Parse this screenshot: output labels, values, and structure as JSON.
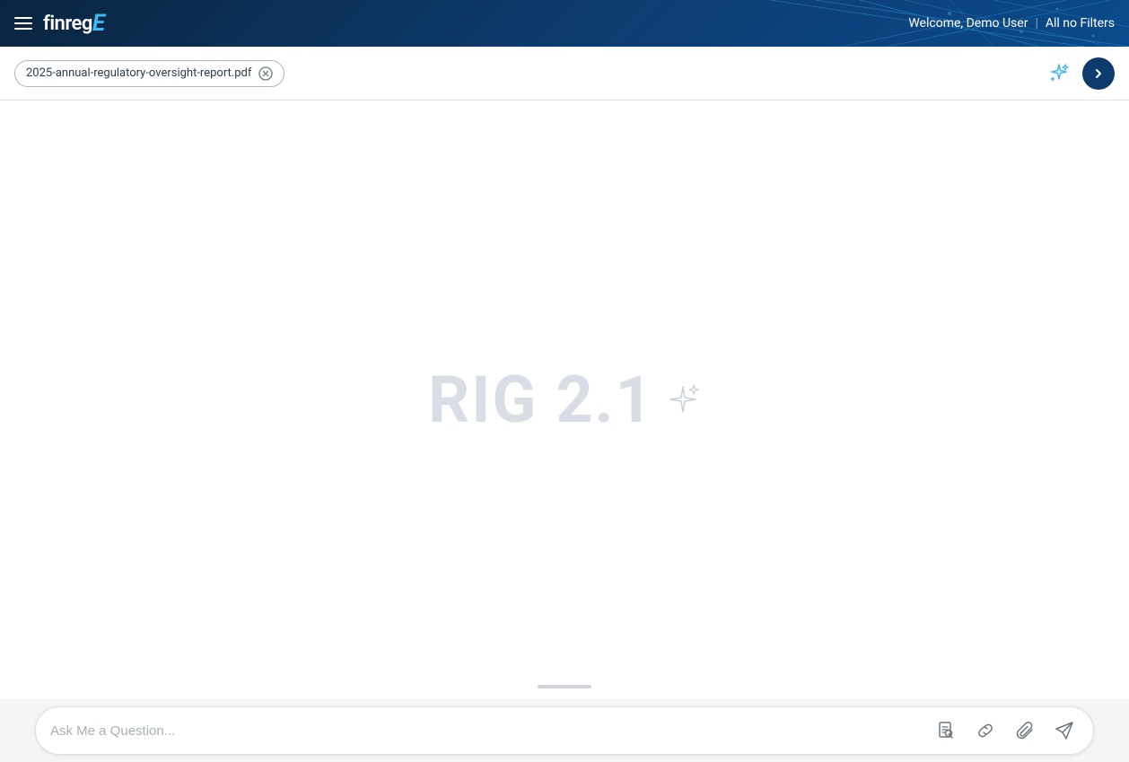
{
  "header": {
    "logo_text": "finreg",
    "logo_letter": "E",
    "welcome_text": "Welcome, Demo User",
    "separator": "|",
    "filters_label": "All no Filters"
  },
  "toolbar": {
    "file_name": "2025-annual-regulatory-oversight-report.pdf",
    "sparkle_icon": "sparkle-icon",
    "nav_arrow_icon": "chevron-right-icon"
  },
  "main": {
    "watermark_text": "RIG 2.1",
    "sparkle_icon": "sparkle-icon"
  },
  "chat": {
    "placeholder": "Ask Me a Question...",
    "document_icon": "document-icon",
    "link_icon": "link-icon",
    "attachment_icon": "attachment-icon",
    "send_icon": "send-icon"
  }
}
